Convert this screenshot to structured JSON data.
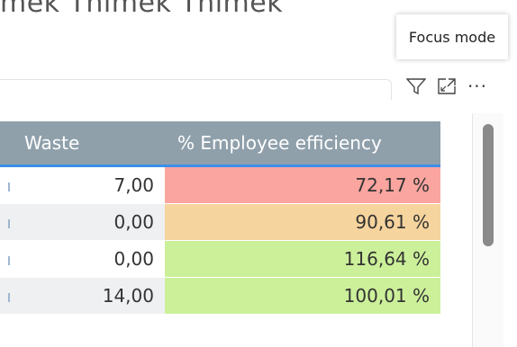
{
  "top_text": "mek Tnimek Tnimek",
  "tooltip": "Focus mode",
  "toolbar": {
    "filter_icon": "filter-icon",
    "focus_icon": "focus-mode-icon",
    "more_label": "···"
  },
  "table": {
    "columns": [
      "Waste",
      "% Employee efficiency"
    ],
    "rows": [
      {
        "waste": "7,00",
        "efficiency": "72,17 %",
        "efficiency_color": "#fba5a0"
      },
      {
        "waste": "0,00",
        "efficiency": "90,61 %",
        "efficiency_color": "#f6d49d"
      },
      {
        "waste": "0,00",
        "efficiency": "116,64 %",
        "efficiency_color": "#ccf09a"
      },
      {
        "waste": "14,00",
        "efficiency": "100,01 %",
        "efficiency_color": "#ccf09a"
      }
    ]
  },
  "colors": {
    "header_bg": "#8fa0ab",
    "header_underline": "#3c8fe6"
  }
}
